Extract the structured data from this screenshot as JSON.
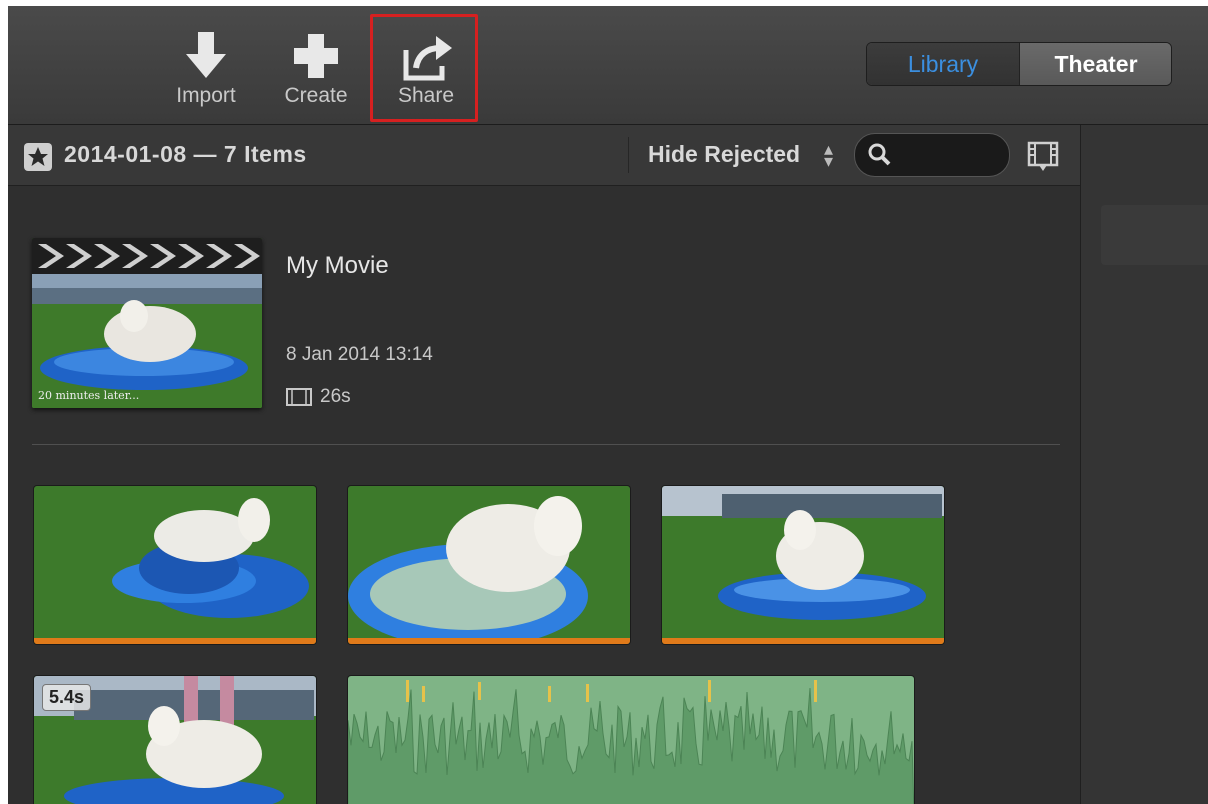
{
  "toolbar": {
    "import_label": "Import",
    "create_label": "Create",
    "share_label": "Share",
    "view_toggle": {
      "library": "Library",
      "theater": "Theater",
      "selected": "Library"
    }
  },
  "filterbar": {
    "event_title": "2014-01-08 — 7 Items",
    "filter_label": "Hide Rejected",
    "search_placeholder": ""
  },
  "movie": {
    "title": "My Movie",
    "date": "8 Jan 2014 13:14",
    "duration": "26s",
    "thumb_caption": "20 minutes later..."
  },
  "clips": [
    {
      "badge": ""
    },
    {
      "badge": ""
    },
    {
      "badge": ""
    },
    {
      "badge": "5.4s"
    }
  ],
  "colors": {
    "accent": "#3b8fe0",
    "highlight_outline": "#d62020",
    "favorite_bar": "#e07a1a",
    "audio_clip": "#7fb486"
  }
}
